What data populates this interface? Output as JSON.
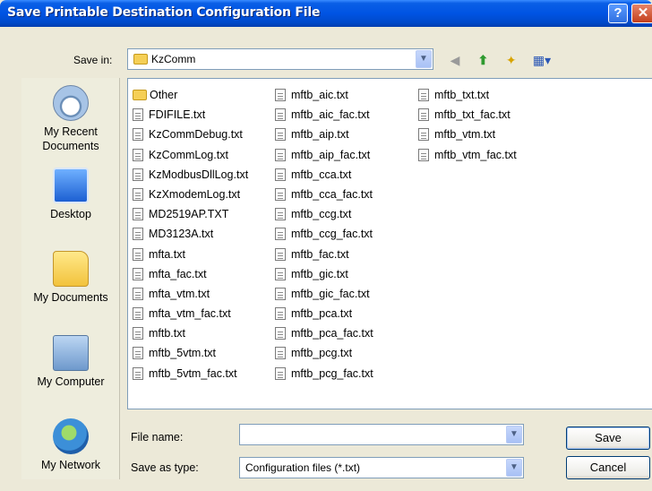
{
  "window": {
    "title": "Save Printable Destination Configuration File",
    "help_label": "?",
    "close_label": "✕"
  },
  "save_in": {
    "label": "Save in:",
    "value": "KzComm"
  },
  "toolbar": {
    "back_icon": "back-arrow-icon",
    "up_icon": "up-folder-icon",
    "new_folder_icon": "new-folder-icon",
    "view_menu_icon": "view-menu-icon"
  },
  "places": [
    {
      "label_line1": "My Recent",
      "label_line2": "Documents",
      "icon": "recent-documents-icon"
    },
    {
      "label_line1": "Desktop",
      "label_line2": "",
      "icon": "desktop-icon"
    },
    {
      "label_line1": "My Documents",
      "label_line2": "",
      "icon": "my-documents-icon"
    },
    {
      "label_line1": "My Computer",
      "label_line2": "",
      "icon": "my-computer-icon"
    },
    {
      "label_line1": "My Network",
      "label_line2": "",
      "icon": "my-network-icon"
    }
  ],
  "files": {
    "col1": [
      "Other",
      "FDIFILE.txt",
      "KzCommDebug.txt",
      "KzCommLog.txt",
      "KzModbusDllLog.txt",
      "KzXmodemLog.txt",
      "MD2519AP.TXT",
      "MD3123A.txt",
      "mfta.txt",
      "mfta_fac.txt",
      "mfta_vtm.txt",
      "mfta_vtm_fac.txt",
      "mftb.txt",
      "mftb_5vtm.txt",
      "mftb_5vtm_fac.txt"
    ],
    "col2": [
      "mftb_aic.txt",
      "mftb_aic_fac.txt",
      "mftb_aip.txt",
      "mftb_aip_fac.txt",
      "mftb_cca.txt",
      "mftb_cca_fac.txt",
      "mftb_ccg.txt",
      "mftb_ccg_fac.txt",
      "mftb_fac.txt",
      "mftb_gic.txt",
      "mftb_gic_fac.txt",
      "mftb_pca.txt",
      "mftb_pca_fac.txt",
      "mftb_pcg.txt",
      "mftb_pcg_fac.txt"
    ],
    "col3": [
      "mftb_txt.txt",
      "mftb_txt_fac.txt",
      "mftb_vtm.txt",
      "mftb_vtm_fac.txt"
    ]
  },
  "file_name": {
    "label": "File name:",
    "value": ""
  },
  "save_as_type": {
    "label": "Save as type:",
    "value": "Configuration files (*.txt)"
  },
  "buttons": {
    "save": "Save",
    "cancel": "Cancel"
  }
}
